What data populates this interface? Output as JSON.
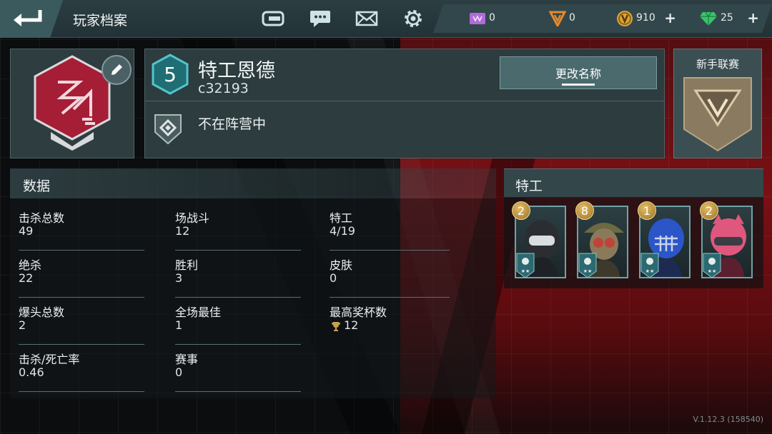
{
  "header": {
    "title": "玩家档案"
  },
  "currencies": [
    {
      "name": "tickets",
      "value": "0",
      "color": "#b06bd8"
    },
    {
      "name": "vip-coins",
      "value": "0",
      "color": "#e88a2a"
    },
    {
      "name": "gold",
      "value": "910",
      "color": "#d9a23a",
      "plus": "+"
    },
    {
      "name": "gems",
      "value": "25",
      "color": "#39c46b",
      "plus": "+"
    }
  ],
  "profile": {
    "level": "5",
    "name": "特工恩德",
    "id": "c32193",
    "rename_button": "更改名称",
    "faction": "不在阵营中",
    "league": "新手联赛"
  },
  "stats": {
    "title": "数据",
    "items": [
      {
        "label": "击杀总数",
        "value": "49"
      },
      {
        "label": "绝杀",
        "value": "22"
      },
      {
        "label": "爆头总数",
        "value": "2"
      },
      {
        "label": "击杀/死亡率",
        "value": "0.46"
      },
      {
        "label": "场战斗",
        "value": "12"
      },
      {
        "label": "胜利",
        "value": "3"
      },
      {
        "label": "全场最佳",
        "value": "1"
      },
      {
        "label": "赛事",
        "value": "0"
      },
      {
        "label": "特工",
        "value": "4/19"
      },
      {
        "label": "皮肤",
        "value": "0"
      },
      {
        "label": "最高奖杯数",
        "value": "12"
      }
    ]
  },
  "agents": {
    "title": "特工",
    "items": [
      {
        "level": "2",
        "helmet": "#2a2e33",
        "visor": "#d8dde0"
      },
      {
        "level": "8",
        "helmet": "#6b6a42",
        "visor": "#c0433a"
      },
      {
        "level": "1",
        "helmet": "#2c55c8",
        "visor": "#c7d3e8"
      },
      {
        "level": "2",
        "helmet": "#e0577d",
        "visor": "#3b3d44"
      }
    ]
  },
  "version": "V.1.12.3 (158540)"
}
